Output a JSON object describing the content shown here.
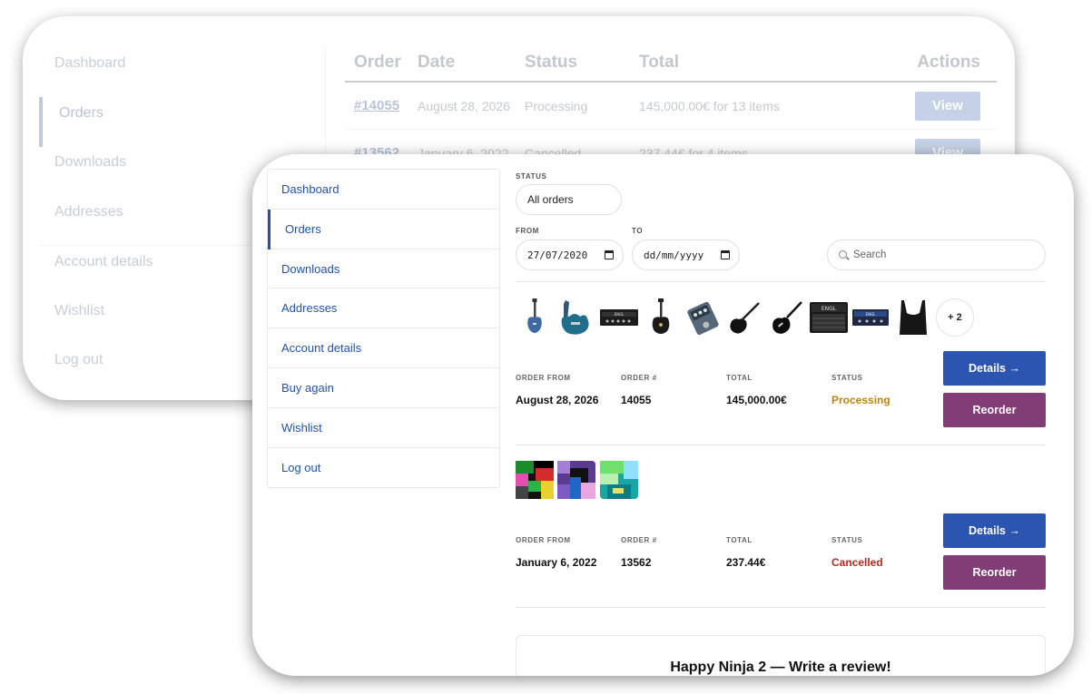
{
  "back": {
    "nav": [
      "Dashboard",
      "Orders",
      "Downloads",
      "Addresses",
      "Account details",
      "Wishlist",
      "Log out"
    ],
    "table": {
      "headers": {
        "order": "Order",
        "date": "Date",
        "status": "Status",
        "total": "Total",
        "actions": "Actions"
      },
      "rows": [
        {
          "order": "#14055",
          "date": "August 28, 2026",
          "status": "Processing",
          "total": "145,000.00€ for 13 items",
          "action": "View"
        },
        {
          "order": "#13562",
          "date": "January 6, 2022",
          "status": "Cancelled",
          "total": "237.44€ for 4 items",
          "action": "View"
        }
      ]
    }
  },
  "front": {
    "nav": [
      "Dashboard",
      "Orders",
      "Downloads",
      "Addresses",
      "Account details",
      "Buy again",
      "Wishlist",
      "Log out"
    ],
    "filters": {
      "status_label": "STATUS",
      "status_value": "All orders",
      "from_label": "FROM",
      "from_value": "27/07/2020",
      "to_label": "TO",
      "to_value": "dd/mm/yyyy",
      "search_placeholder": "Search"
    },
    "orders": [
      {
        "thumbs": [
          "guitar-icon",
          "guitar-icon",
          "amp-icon",
          "guitar-icon",
          "pedal-icon",
          "guitar-icon",
          "guitar-icon",
          "amp-icon",
          "amp-icon",
          "top-icon"
        ],
        "more": "+ 2",
        "labels": {
          "from": "ORDER FROM",
          "num": "ORDER #",
          "total": "TOTAL",
          "status": "STATUS"
        },
        "from": "August 28, 2026",
        "num": "14055",
        "total": "145,000.00€",
        "status": "Processing",
        "details": "Details →",
        "reorder": "Reorder"
      },
      {
        "thumbs": [
          "pixel-art-icon",
          "pixel-art-icon",
          "pixel-art-icon"
        ],
        "labels": {
          "from": "ORDER FROM",
          "num": "ORDER #",
          "total": "TOTAL",
          "status": "STATUS"
        },
        "from": "January 6, 2022",
        "num": "13562",
        "total": "237.44€",
        "status": "Cancelled",
        "details": "Details →",
        "reorder": "Reorder"
      }
    ],
    "review": "Happy Ninja 2 — Write a review!"
  },
  "colors": {
    "accent": "#2452a8",
    "details_btn": "#2b55b0",
    "reorder_btn": "#823d77",
    "processing": "#b8860b",
    "cancelled": "#b52a1d"
  }
}
